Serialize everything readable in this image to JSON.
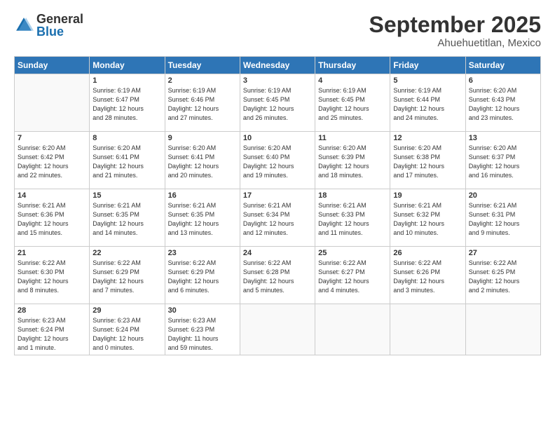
{
  "header": {
    "logo_general": "General",
    "logo_blue": "Blue",
    "month_title": "September 2025",
    "subtitle": "Ahuehuetitlan, Mexico"
  },
  "weekdays": [
    "Sunday",
    "Monday",
    "Tuesday",
    "Wednesday",
    "Thursday",
    "Friday",
    "Saturday"
  ],
  "weeks": [
    [
      {
        "day": "",
        "info": ""
      },
      {
        "day": "1",
        "info": "Sunrise: 6:19 AM\nSunset: 6:47 PM\nDaylight: 12 hours\nand 28 minutes."
      },
      {
        "day": "2",
        "info": "Sunrise: 6:19 AM\nSunset: 6:46 PM\nDaylight: 12 hours\nand 27 minutes."
      },
      {
        "day": "3",
        "info": "Sunrise: 6:19 AM\nSunset: 6:45 PM\nDaylight: 12 hours\nand 26 minutes."
      },
      {
        "day": "4",
        "info": "Sunrise: 6:19 AM\nSunset: 6:45 PM\nDaylight: 12 hours\nand 25 minutes."
      },
      {
        "day": "5",
        "info": "Sunrise: 6:19 AM\nSunset: 6:44 PM\nDaylight: 12 hours\nand 24 minutes."
      },
      {
        "day": "6",
        "info": "Sunrise: 6:20 AM\nSunset: 6:43 PM\nDaylight: 12 hours\nand 23 minutes."
      }
    ],
    [
      {
        "day": "7",
        "info": "Sunrise: 6:20 AM\nSunset: 6:42 PM\nDaylight: 12 hours\nand 22 minutes."
      },
      {
        "day": "8",
        "info": "Sunrise: 6:20 AM\nSunset: 6:41 PM\nDaylight: 12 hours\nand 21 minutes."
      },
      {
        "day": "9",
        "info": "Sunrise: 6:20 AM\nSunset: 6:41 PM\nDaylight: 12 hours\nand 20 minutes."
      },
      {
        "day": "10",
        "info": "Sunrise: 6:20 AM\nSunset: 6:40 PM\nDaylight: 12 hours\nand 19 minutes."
      },
      {
        "day": "11",
        "info": "Sunrise: 6:20 AM\nSunset: 6:39 PM\nDaylight: 12 hours\nand 18 minutes."
      },
      {
        "day": "12",
        "info": "Sunrise: 6:20 AM\nSunset: 6:38 PM\nDaylight: 12 hours\nand 17 minutes."
      },
      {
        "day": "13",
        "info": "Sunrise: 6:20 AM\nSunset: 6:37 PM\nDaylight: 12 hours\nand 16 minutes."
      }
    ],
    [
      {
        "day": "14",
        "info": "Sunrise: 6:21 AM\nSunset: 6:36 PM\nDaylight: 12 hours\nand 15 minutes."
      },
      {
        "day": "15",
        "info": "Sunrise: 6:21 AM\nSunset: 6:35 PM\nDaylight: 12 hours\nand 14 minutes."
      },
      {
        "day": "16",
        "info": "Sunrise: 6:21 AM\nSunset: 6:35 PM\nDaylight: 12 hours\nand 13 minutes."
      },
      {
        "day": "17",
        "info": "Sunrise: 6:21 AM\nSunset: 6:34 PM\nDaylight: 12 hours\nand 12 minutes."
      },
      {
        "day": "18",
        "info": "Sunrise: 6:21 AM\nSunset: 6:33 PM\nDaylight: 12 hours\nand 11 minutes."
      },
      {
        "day": "19",
        "info": "Sunrise: 6:21 AM\nSunset: 6:32 PM\nDaylight: 12 hours\nand 10 minutes."
      },
      {
        "day": "20",
        "info": "Sunrise: 6:21 AM\nSunset: 6:31 PM\nDaylight: 12 hours\nand 9 minutes."
      }
    ],
    [
      {
        "day": "21",
        "info": "Sunrise: 6:22 AM\nSunset: 6:30 PM\nDaylight: 12 hours\nand 8 minutes."
      },
      {
        "day": "22",
        "info": "Sunrise: 6:22 AM\nSunset: 6:29 PM\nDaylight: 12 hours\nand 7 minutes."
      },
      {
        "day": "23",
        "info": "Sunrise: 6:22 AM\nSunset: 6:29 PM\nDaylight: 12 hours\nand 6 minutes."
      },
      {
        "day": "24",
        "info": "Sunrise: 6:22 AM\nSunset: 6:28 PM\nDaylight: 12 hours\nand 5 minutes."
      },
      {
        "day": "25",
        "info": "Sunrise: 6:22 AM\nSunset: 6:27 PM\nDaylight: 12 hours\nand 4 minutes."
      },
      {
        "day": "26",
        "info": "Sunrise: 6:22 AM\nSunset: 6:26 PM\nDaylight: 12 hours\nand 3 minutes."
      },
      {
        "day": "27",
        "info": "Sunrise: 6:22 AM\nSunset: 6:25 PM\nDaylight: 12 hours\nand 2 minutes."
      }
    ],
    [
      {
        "day": "28",
        "info": "Sunrise: 6:23 AM\nSunset: 6:24 PM\nDaylight: 12 hours\nand 1 minute."
      },
      {
        "day": "29",
        "info": "Sunrise: 6:23 AM\nSunset: 6:24 PM\nDaylight: 12 hours\nand 0 minutes."
      },
      {
        "day": "30",
        "info": "Sunrise: 6:23 AM\nSunset: 6:23 PM\nDaylight: 11 hours\nand 59 minutes."
      },
      {
        "day": "",
        "info": ""
      },
      {
        "day": "",
        "info": ""
      },
      {
        "day": "",
        "info": ""
      },
      {
        "day": "",
        "info": ""
      }
    ]
  ]
}
